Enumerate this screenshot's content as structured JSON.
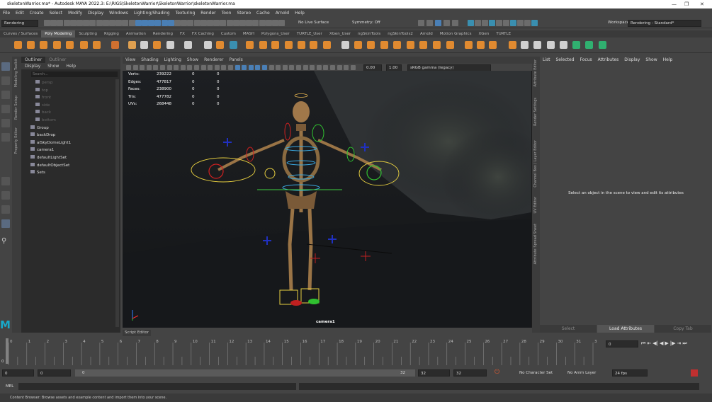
{
  "window": {
    "title": "skeletonWarrior.ma* - Autodesk MAYA 2022.3: E:\\RIGS\\SkeletonWarrior\\SkeletonWarrior\\skeletonWarrior.ma",
    "minimize": "—",
    "maximize": "❐",
    "close": "✕"
  },
  "menubar": [
    "File",
    "Edit",
    "Create",
    "Select",
    "Modify",
    "Display",
    "Windows",
    "Lighting/Shading",
    "Texturing",
    "Render",
    "Toon",
    "Stereo",
    "Cache",
    "Arnold",
    "Help"
  ],
  "statusline": {
    "menuset": "Rendering",
    "live_surface": "No Live Surface",
    "symmetry": "Symmetry: Off",
    "workspace_label": "Workspace:",
    "workspace_value": "Rendering - Standard*"
  },
  "shelf_tabs": [
    "Curves / Surfaces",
    "Poly Modeling",
    "Sculpting",
    "Rigging",
    "Animation",
    "Rendering",
    "FX",
    "FX Caching",
    "Custom",
    "MASH",
    "Polygons_User",
    "TURTLE_User",
    "XGen_User",
    "ngSkinTools",
    "ngSkinTools2",
    "Arnold",
    "Motion Graphics",
    "XGen",
    "TURTLE"
  ],
  "shelf_active": "Poly Modeling",
  "side_tabs": {
    "modeling_toolkit": "Modeling Toolkit",
    "render_setup": "Render Setup",
    "property_editor": "Property Editor"
  },
  "outliner": {
    "tabs": [
      "Outliner",
      "Outliner"
    ],
    "menu": [
      "Display",
      "Show",
      "Help"
    ],
    "search_placeholder": "Search...",
    "items": [
      {
        "label": "persp",
        "dim": true
      },
      {
        "label": "top",
        "dim": true
      },
      {
        "label": "front",
        "dim": true
      },
      {
        "label": "side",
        "dim": true
      },
      {
        "label": "back",
        "dim": true
      },
      {
        "label": "bottom",
        "dim": true
      },
      {
        "label": "Group",
        "dim": false
      },
      {
        "label": "backDrop",
        "dim": false
      },
      {
        "label": "aiSkyDomeLight1",
        "dim": false
      },
      {
        "label": "camera1",
        "dim": false
      },
      {
        "label": "defaultLightSet",
        "dim": false
      },
      {
        "label": "defaultObjectSet",
        "dim": false
      },
      {
        "label": "Sets",
        "dim": false
      }
    ]
  },
  "viewport": {
    "menu": [
      "View",
      "Shading",
      "Lighting",
      "Show",
      "Renderer",
      "Panels"
    ],
    "exposure": "0.00",
    "gamma": "1.00",
    "color_space": "sRGB gamma (legacy)",
    "camera_name": "camera1",
    "hud": {
      "labels": [
        "Verts:",
        "Edges:",
        "Faces:",
        "Tris:",
        "UVs:"
      ],
      "values": [
        "239222",
        "477817",
        "238900",
        "477782",
        "268448"
      ],
      "sel_a": [
        "0",
        "0",
        "0",
        "0",
        "0"
      ],
      "sel_b": [
        "0",
        "0",
        "0",
        "0",
        "0"
      ]
    }
  },
  "attribute_editor": {
    "menu": [
      "List",
      "Selected",
      "Focus",
      "Attributes",
      "Display",
      "Show",
      "Help"
    ],
    "message": "Select an object in the scene to view and edit its attributes",
    "buttons": [
      "Select",
      "Load Attributes",
      "Copy Tab"
    ],
    "side_tabs": {
      "attr": "Attribute Editor",
      "render": "Render Settings",
      "channel": "Channel Box / Layer Editor",
      "uv": "UV Editor",
      "spread": "Attribute Spread Sheet"
    }
  },
  "script_editor": "Script Editor",
  "timeline": {
    "ticks": [
      "0",
      "1",
      "2",
      "3",
      "4",
      "5",
      "6",
      "7",
      "8",
      "9",
      "10",
      "11",
      "12",
      "13",
      "14",
      "15",
      "16",
      "17",
      "18",
      "19",
      "20",
      "21",
      "22",
      "23",
      "24",
      "25",
      "26",
      "27",
      "28",
      "29",
      "30",
      "31",
      "32"
    ],
    "current": "0",
    "current_frame_field": "0"
  },
  "range": {
    "start": "0",
    "anim_start": "0",
    "slider_start": "0",
    "slider_end": "32",
    "anim_end": "32",
    "end": "32",
    "character_set": "No Character Set",
    "anim_layer": "No Anim Layer",
    "fps": "24 fps"
  },
  "cmdline": {
    "lang": "MEL"
  },
  "help_line": "Content Browser: Browse assets and example content and import them into your scene."
}
